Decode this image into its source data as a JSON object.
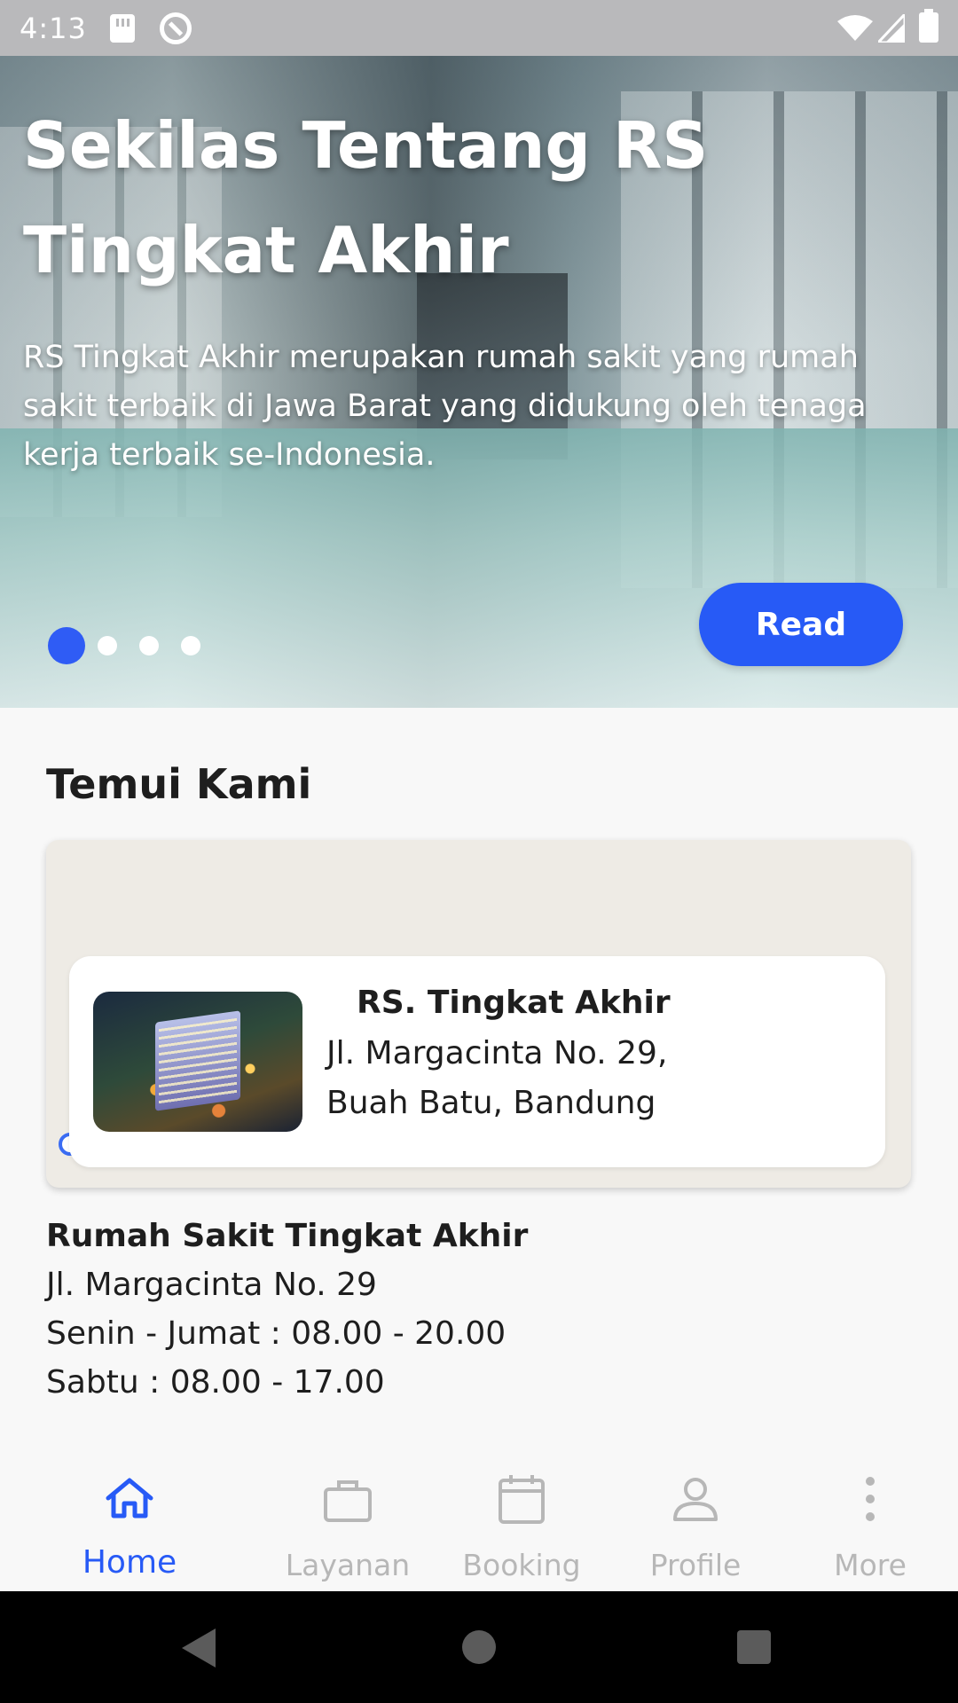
{
  "status_bar": {
    "time": "4:13",
    "icons": [
      "sd-card-icon",
      "sync-icon",
      "wifi-icon",
      "cell-signal-icon",
      "battery-icon"
    ]
  },
  "hero": {
    "title": "Sekilas Tentang RS Tingkat Akhir",
    "description": "RS Tingkat Akhir merupakan rumah sakit yang rumah sakit terbaik di Jawa Barat yang didukung oleh tenaga kerja terbaik se-Indonesia.",
    "read_label": "Read",
    "slide_count": 4,
    "active_slide": 1
  },
  "section": {
    "title": "Temui Kami"
  },
  "map_info": {
    "name": "RS. Tingkat Akhir",
    "address_line1": "Jl. Margacinta No. 29,",
    "address_line2": "Buah Batu, Bandung"
  },
  "details": {
    "title": "Rumah Sakit Tingkat Akhir",
    "address": "Jl. Margacinta No. 29",
    "hours_weekday": "Senin - Jumat : 08.00 - 20.00",
    "hours_saturday": "Sabtu : 08.00 - 17.00"
  },
  "bottom_nav": {
    "items": [
      {
        "label": "Home",
        "icon": "home-icon",
        "active": true
      },
      {
        "label": "Layanan",
        "icon": "briefcase-icon",
        "active": false
      },
      {
        "label": "Booking",
        "icon": "calendar-icon",
        "active": false
      },
      {
        "label": "Profile",
        "icon": "person-icon",
        "active": false
      },
      {
        "label": "More",
        "icon": "more-vertical-icon",
        "active": false
      }
    ]
  },
  "colors": {
    "accent": "#275af6",
    "inactive": "#b7b7b7",
    "background": "#f8f8f8"
  }
}
